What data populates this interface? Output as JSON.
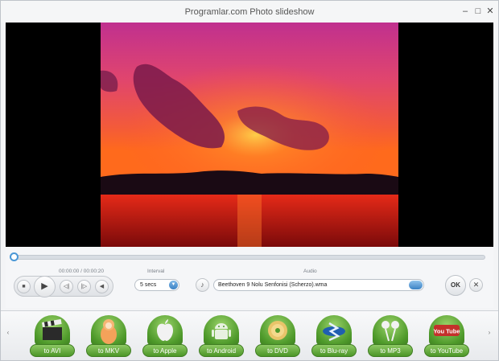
{
  "window": {
    "title": "Programlar.com Photo slideshow",
    "minimize_glyph": "–",
    "maximize_glyph": "□",
    "close_glyph": "✕"
  },
  "player": {
    "time": "00:00:00 / 00:00:20",
    "progress": 0.0,
    "stop_glyph": "■",
    "play_glyph": "▶",
    "prev_glyph": "◁|",
    "next_glyph": "|▷",
    "volume_glyph": "◀"
  },
  "interval": {
    "label": "Interval",
    "value": "5 secs"
  },
  "audio": {
    "label": "Audio",
    "value": "Beethoven 9 Nolu Senfonisi (Scherzo).wma",
    "note_glyph": "♪"
  },
  "actions": {
    "ok_label": "OK",
    "cancel_glyph": "✕"
  },
  "converters": [
    {
      "label": "to AVI",
      "icon": "clapperboard-icon"
    },
    {
      "label": "to MKV",
      "icon": "matryoshka-icon"
    },
    {
      "label": "to Apple",
      "icon": "apple-icon"
    },
    {
      "label": "to Android",
      "icon": "android-icon"
    },
    {
      "label": "to DVD",
      "icon": "disc-icon"
    },
    {
      "label": "to Blu-ray",
      "icon": "bluray-icon"
    },
    {
      "label": "to MP3",
      "icon": "earbuds-icon"
    },
    {
      "label": "to YouTube",
      "icon": "youtube-icon"
    }
  ],
  "scroll": {
    "left_glyph": "‹",
    "right_glyph": "›"
  },
  "youtube_logo_text": "You Tube",
  "colors": {
    "accent": "#3b82c4",
    "converter_green": "#5fa637",
    "stage": "#000000"
  }
}
